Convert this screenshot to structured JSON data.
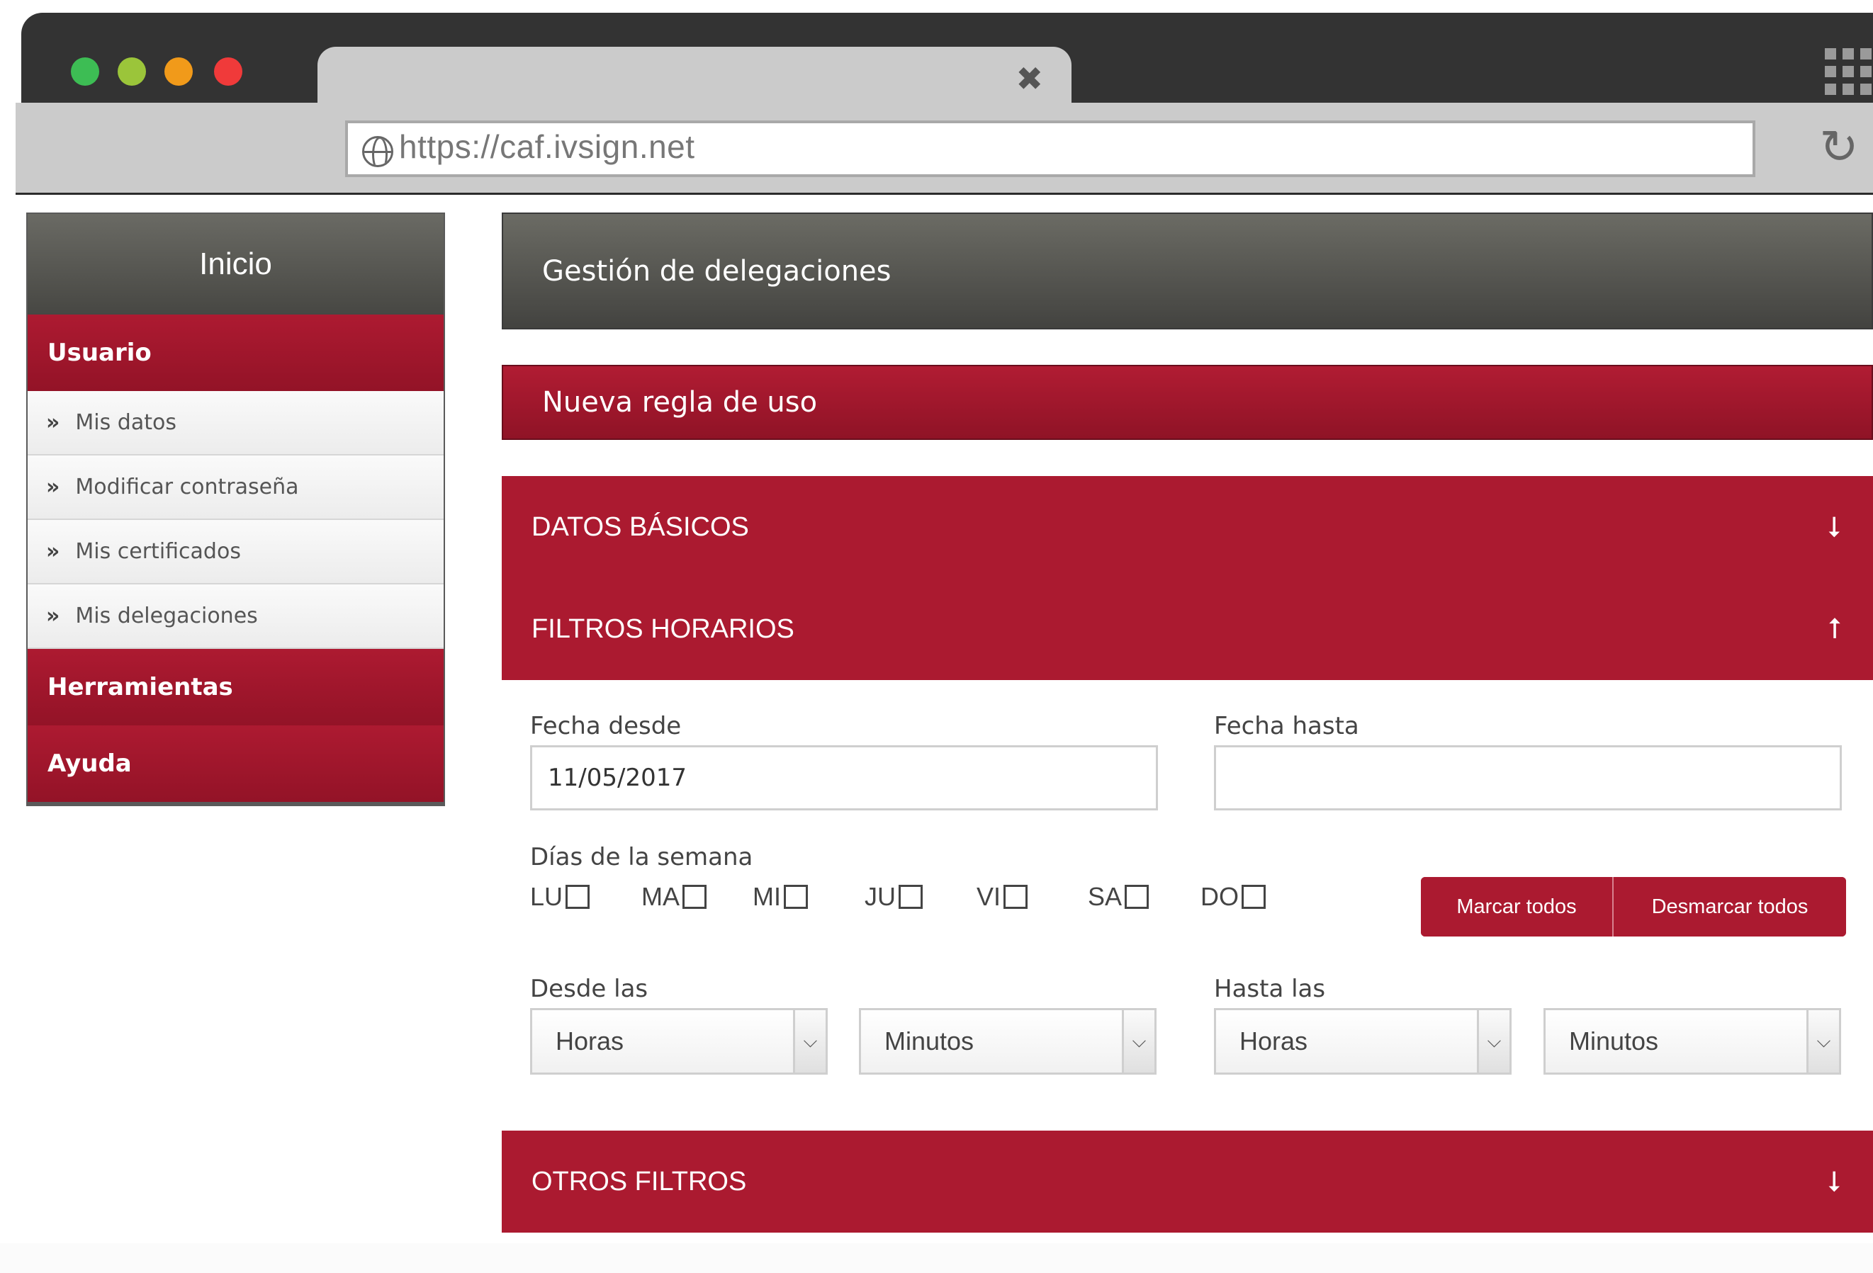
{
  "browser": {
    "url": "https://caf.ivsign.net",
    "close_glyph": "✖",
    "reload_glyph": "↻",
    "icons": [
      "close-icon",
      "apps-grid-icon",
      "globe-icon",
      "reload-icon"
    ],
    "traffic_light_colors": [
      "#3dbd54",
      "#9bc53a",
      "#f19a1a",
      "#f03a3a"
    ]
  },
  "sidebar": {
    "home": "Inicio",
    "sections": {
      "usuario": "Usuario",
      "herramientas": "Herramientas",
      "ayuda": "Ayuda"
    },
    "bullet": "»",
    "items": [
      {
        "label": "Mis datos"
      },
      {
        "label": "Modificar contraseña"
      },
      {
        "label": "Mis certificados"
      },
      {
        "label": "Mis delegaciones"
      }
    ]
  },
  "main": {
    "page_title": "Gestión de delegaciones",
    "subtitle": "Nueva regla de uso",
    "accordions": {
      "basic": {
        "label": "DATOS BÁSICOS",
        "arrow": "⭣"
      },
      "time": {
        "label": "FILTROS HORARIOS",
        "arrow": "⭡"
      },
      "other": {
        "label": "OTROS FILTROS",
        "arrow": "⭣"
      }
    },
    "form": {
      "date_from_label": "Fecha desde",
      "date_from_value": "11/05/2017",
      "date_to_label": "Fecha hasta",
      "date_to_value": "",
      "weekdays_label": "Días de la semana",
      "weekdays": [
        "LU",
        "MA",
        "MI",
        "JU",
        "VI",
        "SA",
        "DO"
      ],
      "check_all": "Marcar todos",
      "uncheck_all": "Desmarcar todos",
      "from_time_label": "Desde las",
      "to_time_label": "Hasta las",
      "hours_placeholder": "Horas",
      "minutes_placeholder": "Minutos",
      "chevron_glyph": "⌵"
    }
  },
  "colors": {
    "brand_red": "#ab1a30",
    "dark_header": "#555550"
  }
}
